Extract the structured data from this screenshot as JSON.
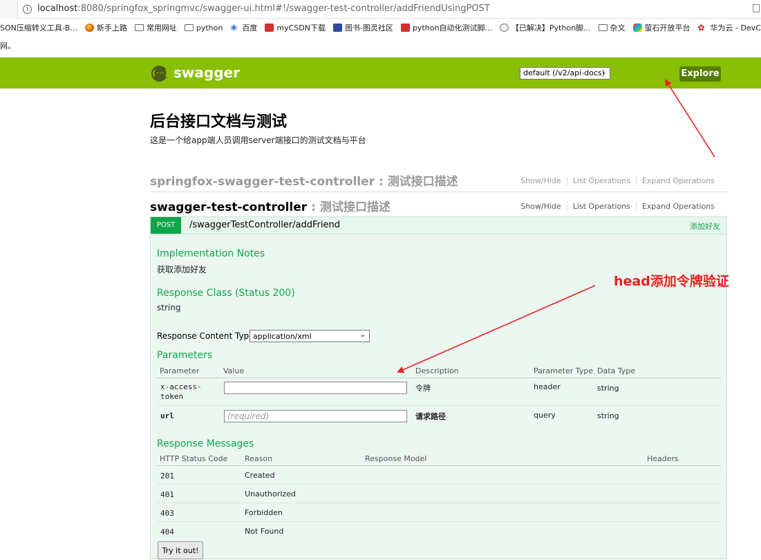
{
  "browser": {
    "url_host": "localhost",
    "url_rest": ":8080/springfox_springmvc/swagger-ui.html#!/swagger-test-controller/addFriendUsingPOST",
    "bookmarks": [
      {
        "label": "SON压缩转义工具-B...",
        "icon": "none"
      },
      {
        "label": "新手上路",
        "icon": "firefox-icon"
      },
      {
        "label": "常用网址",
        "icon": "folder-icon"
      },
      {
        "label": "python",
        "icon": "folder-icon"
      },
      {
        "label": "百度",
        "icon": "baidu-paw-icon"
      },
      {
        "label": "myCSDN下载",
        "icon": "csdn-icon"
      },
      {
        "label": "图书-图灵社区",
        "icon": "book-icon"
      },
      {
        "label": "python自动化测试脚...",
        "icon": "csdn-icon"
      },
      {
        "label": "【已解决】Python脚...",
        "icon": "globe-icon"
      },
      {
        "label": "杂文",
        "icon": "folder-icon"
      },
      {
        "label": "萤石开放平台",
        "icon": "ezviz-icon"
      },
      {
        "label": "华为云 - DevCloud",
        "icon": "huawei-icon"
      }
    ],
    "sub_strip": "网。"
  },
  "header": {
    "logo_glyph": "{···}",
    "title": "swagger",
    "api_select": "default (/v2/api-docs)",
    "explore_label": "Explore"
  },
  "info": {
    "title": "后台接口文档与测试",
    "description": "这是一个给app端人员调用server端接口的测试文档与平台"
  },
  "resources": [
    {
      "name": "springfox-swagger-test-controller",
      "sep": " : ",
      "desc": "测试接口描述",
      "ops": [
        "Show/Hide",
        "List Operations",
        "Expand Operations"
      ]
    },
    {
      "name": "swagger-test-controller",
      "sep": " : ",
      "desc": "测试接口描述",
      "ops": [
        "Show/Hide",
        "List Operations",
        "Expand Operations"
      ]
    }
  ],
  "operation": {
    "method": "POST",
    "path": "/swaggerTestController/addFriend",
    "summary": "添加好友",
    "impl_notes_heading": "Implementation Notes",
    "impl_notes": "获取添加好友",
    "response_class_heading": "Response Class (Status 200)",
    "response_class": "string",
    "response_content_type_label": "Response Content Type",
    "response_content_type": "application/xml",
    "parameters_heading": "Parameters",
    "param_columns": [
      "Parameter",
      "Value",
      "Description",
      "Parameter Type",
      "Data Type"
    ],
    "params": [
      {
        "name": "x-access-\ntoken",
        "value_placeholder": "",
        "description": "令牌",
        "param_type": "header",
        "data_type": "string"
      },
      {
        "name": "url",
        "value_placeholder": "(required)",
        "description": "请求路径",
        "param_type": "query",
        "data_type": "string"
      }
    ],
    "response_messages_heading": "Response Messages",
    "resp_columns": [
      "HTTP Status Code",
      "Reason",
      "Response Model",
      "Headers"
    ],
    "responses": [
      {
        "code": "201",
        "reason": "Created"
      },
      {
        "code": "401",
        "reason": "Unauthorized"
      },
      {
        "code": "403",
        "reason": "Forbidden"
      },
      {
        "code": "404",
        "reason": "Not Found"
      }
    ],
    "try_label": "Try it out!"
  },
  "annotation": {
    "text": "head添加令牌验证",
    "color": "#ea1f1f"
  },
  "colors": {
    "header_green": "#89bf04",
    "post_green": "#10a54a",
    "explore_dark": "#547f00"
  }
}
